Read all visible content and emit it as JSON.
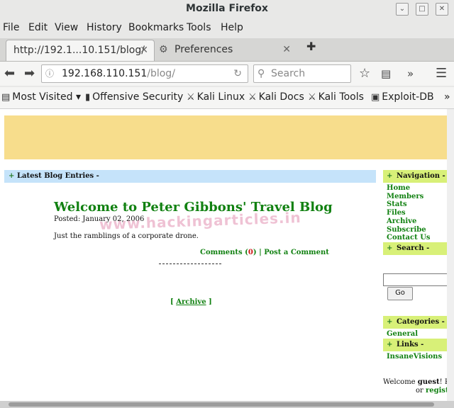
{
  "window": {
    "title": "Mozilla Firefox",
    "controls": [
      "⌄",
      "□",
      "✕"
    ]
  },
  "menu": [
    "File",
    "Edit",
    "View",
    "History",
    "Bookmarks",
    "Tools",
    "Help"
  ],
  "tabs": [
    {
      "label": "http://192.1...10.151/blog/",
      "close": "✕"
    },
    {
      "label": "Preferences",
      "close": "✕"
    }
  ],
  "navbar": {
    "url_host": "192.168.110.151",
    "url_path": "/blog/",
    "search_placeholder": "Search"
  },
  "bookmarks": [
    "Most Visited ▾",
    "Offensive Security",
    "Kali Linux",
    "Kali Docs",
    "Kali Tools",
    "Exploit-DB",
    "»"
  ],
  "page": {
    "blue_bar": "Latest Blog Entries  -",
    "blog_title": "Welcome to Peter Gibbons' Travel Blog",
    "posted": "Posted: January 02, 2006",
    "body": "Just the ramblings of a corporate drone.",
    "comments_label": "Comments",
    "comments_count": "0",
    "post_comment": "Post a Comment",
    "separator": "-----------------------------------",
    "archive_link": "Archive",
    "watermark": "www.hackingarticles.in"
  },
  "sidebar": {
    "navigation_title": "Navigation  -",
    "nav_links": [
      "Home",
      "Members",
      "Stats",
      "Files",
      "Archive",
      "Subscribe",
      "Contact Us"
    ],
    "search_title": "Search  -",
    "go_button": "Go",
    "categories_title": "Categories  -",
    "categories": [
      "General"
    ],
    "links_title": "Links  -",
    "links": [
      "InsaneVisions"
    ],
    "welcome_text": "Welcome",
    "welcome_user": "guest",
    "welcome_suffix": "! Pl",
    "or_text": "or",
    "register": "regist"
  },
  "colors": {
    "banner": "#f7dd8c",
    "blue_bar": "#c5e3fa",
    "side_head": "#d8f078",
    "link_green": "#118111"
  }
}
